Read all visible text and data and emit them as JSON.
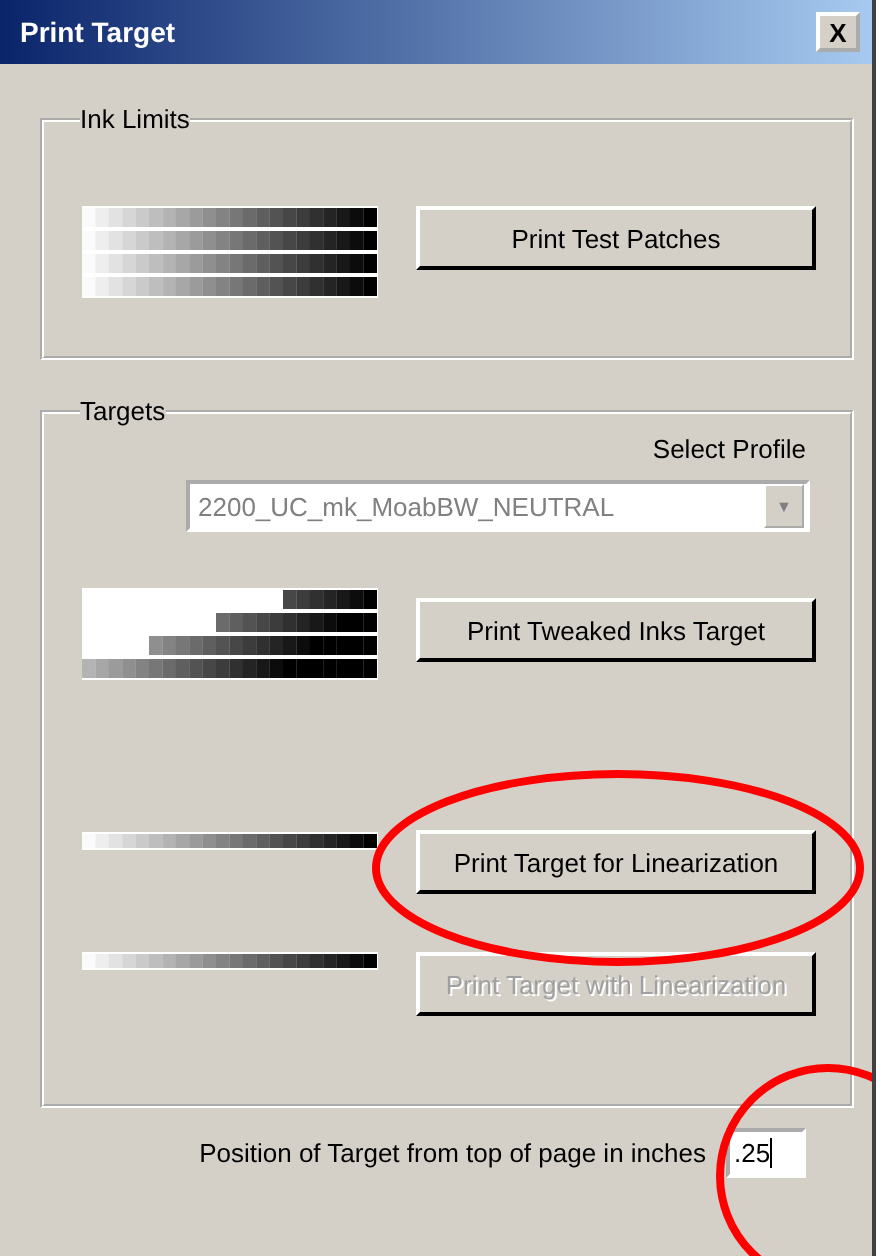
{
  "window": {
    "title": "Print Target",
    "close_label": "X"
  },
  "ink_limits": {
    "title": "Ink Limits",
    "button": "Print Test Patches"
  },
  "targets": {
    "title": "Targets",
    "select_label": "Select Profile",
    "profile": {
      "value": "2200_UC_mk_MoabBW_NEUTRAL",
      "disabled": true,
      "arrow": "▼"
    },
    "buttons": [
      {
        "label": "Print Tweaked Inks Target",
        "disabled": false,
        "kind": "tweaked"
      },
      {
        "label": "Print Target for Linearization",
        "disabled": false,
        "kind": "single"
      },
      {
        "label": "Print Target with Linearization",
        "disabled": true,
        "kind": "single"
      }
    ]
  },
  "position": {
    "label": "Position of Target from top of page in inches",
    "value": ".25"
  }
}
